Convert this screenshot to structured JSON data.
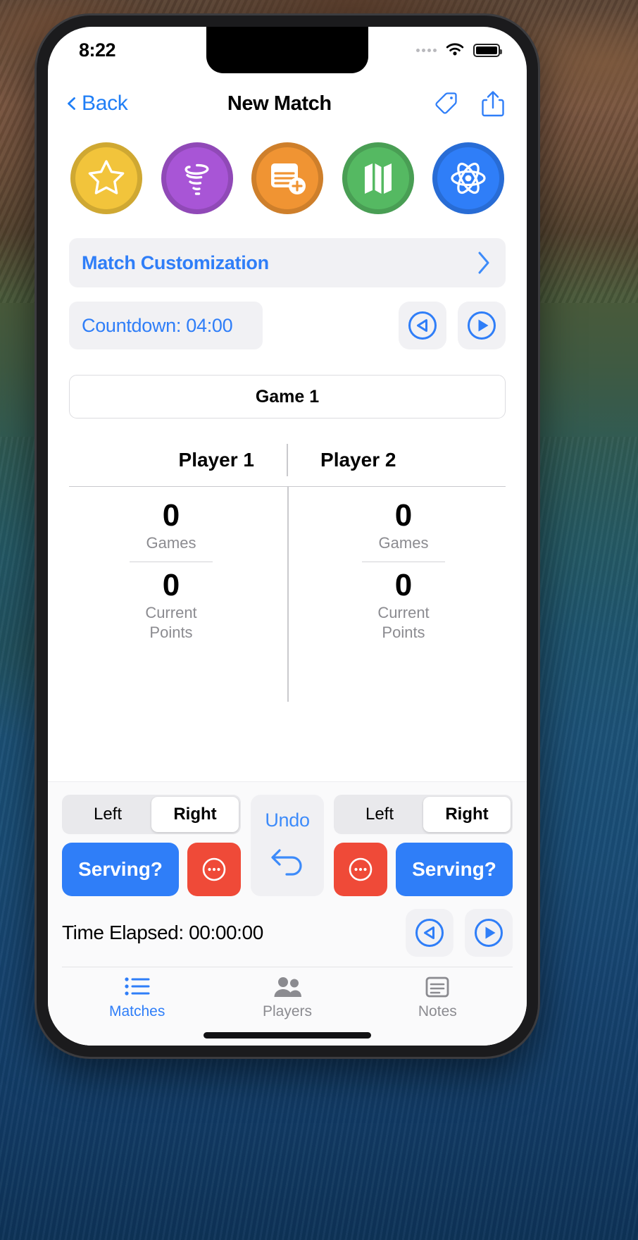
{
  "status_bar": {
    "time": "8:22",
    "signal_icon": "signal-dots-icon",
    "wifi_icon": "wifi-icon",
    "battery_icon": "battery-icon"
  },
  "navbar": {
    "back_label": "Back",
    "back_icon": "chevron-left-icon",
    "title": "New Match",
    "tag_icon": "tag-icon",
    "share_icon": "share-icon"
  },
  "sports": [
    {
      "name": "star",
      "icon": "star-icon",
      "color": "#f2c43b",
      "ring": "#d6a72b"
    },
    {
      "name": "tornado",
      "icon": "tornado-icon",
      "color": "#a855d6",
      "ring": "#8e3fbd"
    },
    {
      "name": "new-note",
      "icon": "note-add-icon",
      "color": "#f09433",
      "ring": "#d67d1e"
    },
    {
      "name": "map",
      "icon": "map-icon",
      "color": "#55b962",
      "ring": "#3e9c4c"
    },
    {
      "name": "atom",
      "icon": "atom-icon",
      "color": "#2f7ef8",
      "ring": "#2566d0"
    }
  ],
  "customization": {
    "label": "Match Customization",
    "chevron_icon": "chevron-right-icon"
  },
  "countdown": {
    "label": "Countdown: 04:00",
    "back_icon": "rewind-circle-icon",
    "play_icon": "play-circle-icon"
  },
  "game": {
    "label": "Game 1"
  },
  "scoreboard": {
    "player1_label": "Player 1",
    "player2_label": "Player 2",
    "games_label": "Games",
    "current_points_label": "Current\nPoints",
    "player1": {
      "games": "0",
      "current_points": "0"
    },
    "player2": {
      "games": "0",
      "current_points": "0"
    }
  },
  "controls": {
    "left_label": "Left",
    "right_label": "Right",
    "selected_side_player1": "Right",
    "selected_side_player2": "Right",
    "serving_label": "Serving?",
    "more_icon": "ellipsis-circle-icon",
    "undo_label": "Undo",
    "undo_icon": "undo-arrow-icon"
  },
  "elapsed": {
    "label": "Time Elapsed: 00:00:00",
    "back_icon": "rewind-circle-icon",
    "play_icon": "play-circle-icon"
  },
  "tabbar": {
    "items": [
      {
        "label": "Matches",
        "icon": "list-bullet-icon",
        "active": true
      },
      {
        "label": "Players",
        "icon": "people-icon",
        "active": false
      },
      {
        "label": "Notes",
        "icon": "note-icon",
        "active": false
      }
    ]
  },
  "colors": {
    "accent_blue": "#2f7ef8",
    "danger_red": "#ef4a38",
    "muted_gray": "#8b8b90",
    "panel_gray": "#f1f1f4"
  }
}
